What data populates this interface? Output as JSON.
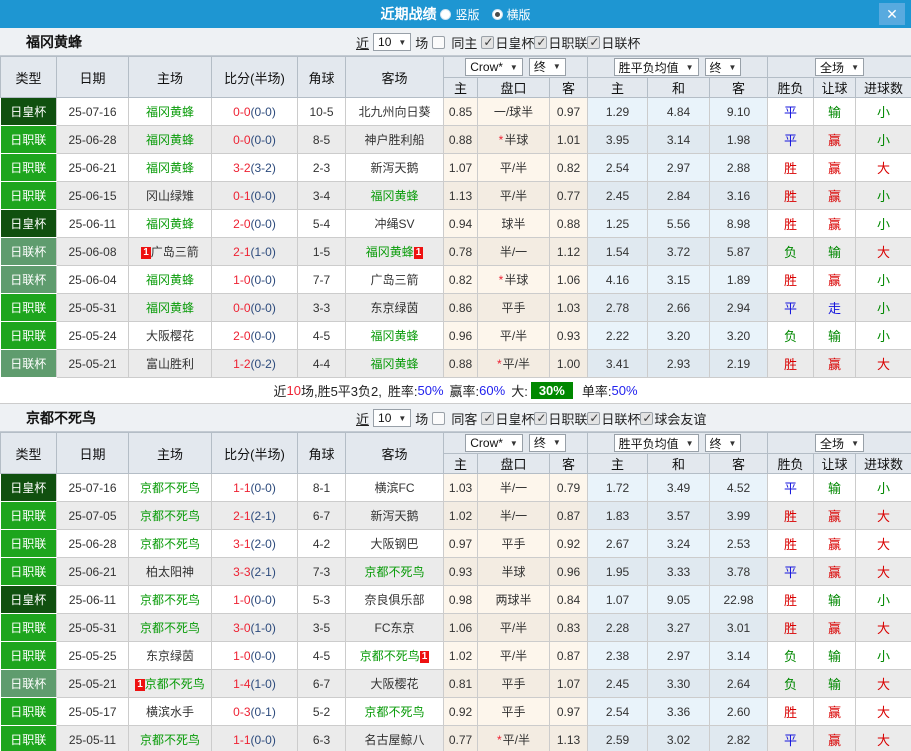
{
  "colors": {
    "titlebar-bg": "#1e96d2",
    "close-bg": "#58aadf",
    "type-emperor": "#10500f",
    "type-j1": "#1da51d",
    "type-lcup": "#5f9c6e",
    "focus-team": "#089b08",
    "score-red": "#ee2233",
    "half-navy": "#2c4a7c",
    "win-red": "#d90000",
    "draw-blue": "#1515dd",
    "lose-green": "#008800",
    "badge-red": "#ee1111",
    "summary-green-bg": "#008800",
    "summary-blue": "#2222ee"
  },
  "titlebar": {
    "title": "近期战绩",
    "radio_vertical": "竖版",
    "radio_horizontal": "横版",
    "close": "✕"
  },
  "table_columns": {
    "main": [
      "类型",
      "日期",
      "主场",
      "比分(半场)",
      "角球",
      "客场"
    ],
    "sub": [
      "主",
      "盘口",
      "客",
      "主",
      "和",
      "客",
      "胜负",
      "让球",
      "进球数"
    ]
  },
  "sections": [
    {
      "team": "福冈黄蜂",
      "filters": {
        "near_label": "近",
        "games": "10",
        "games_label": "场",
        "same_checked": false,
        "same_label": "同主",
        "leagues": [
          "日皇杯",
          "日职联",
          "日联杯"
        ]
      },
      "controls": {
        "odds_source": "Crow*",
        "odds_state": "终",
        "avg_label": "胜平负均值",
        "avg_state": "终",
        "scope": "全场"
      },
      "rows": [
        {
          "type": "日皇杯",
          "date": "25-07-16",
          "home": "福冈黄蜂",
          "home_focus": true,
          "home_card": "",
          "score": "0-0",
          "half": "0-0",
          "corner": "10-5",
          "away": "北九州向日葵",
          "away_focus": false,
          "away_card": "",
          "o_home": "0.85",
          "handicap": "一/球半",
          "h_star": false,
          "o_away": "0.97",
          "a_home": "1.29",
          "a_draw": "4.84",
          "a_away": "9.10",
          "res": "平",
          "hres": "输",
          "goal": "小"
        },
        {
          "type": "日职联",
          "date": "25-06-28",
          "home": "福冈黄蜂",
          "home_focus": true,
          "home_card": "",
          "score": "0-0",
          "half": "0-0",
          "corner": "8-5",
          "away": "神户胜利船",
          "away_focus": false,
          "away_card": "",
          "o_home": "0.88",
          "handicap": "半球",
          "h_star": true,
          "o_away": "1.01",
          "a_home": "3.95",
          "a_draw": "3.14",
          "a_away": "1.98",
          "res": "平",
          "hres": "赢",
          "goal": "小"
        },
        {
          "type": "日职联",
          "date": "25-06-21",
          "home": "福冈黄蜂",
          "home_focus": true,
          "home_card": "",
          "score": "3-2",
          "half": "3-2",
          "corner": "2-3",
          "away": "新泻天鹅",
          "away_focus": false,
          "away_card": "",
          "o_home": "1.07",
          "handicap": "平/半",
          "h_star": false,
          "o_away": "0.82",
          "a_home": "2.54",
          "a_draw": "2.97",
          "a_away": "2.88",
          "res": "胜",
          "hres": "赢",
          "goal": "大"
        },
        {
          "type": "日职联",
          "date": "25-06-15",
          "home": "冈山绿雉",
          "home_focus": false,
          "home_card": "",
          "score": "0-1",
          "half": "0-0",
          "corner": "3-4",
          "away": "福冈黄蜂",
          "away_focus": true,
          "away_card": "",
          "o_home": "1.13",
          "handicap": "平/半",
          "h_star": false,
          "o_away": "0.77",
          "a_home": "2.45",
          "a_draw": "2.84",
          "a_away": "3.16",
          "res": "胜",
          "hres": "赢",
          "goal": "小"
        },
        {
          "type": "日皇杯",
          "date": "25-06-11",
          "home": "福冈黄蜂",
          "home_focus": true,
          "home_card": "",
          "score": "2-0",
          "half": "0-0",
          "corner": "5-4",
          "away": "冲绳SV",
          "away_focus": false,
          "away_card": "",
          "o_home": "0.94",
          "handicap": "球半",
          "h_star": false,
          "o_away": "0.88",
          "a_home": "1.25",
          "a_draw": "5.56",
          "a_away": "8.98",
          "res": "胜",
          "hres": "赢",
          "goal": "小"
        },
        {
          "type": "日联杯",
          "date": "25-06-08",
          "home": "广岛三箭",
          "home_focus": false,
          "home_card": "1",
          "score": "2-1",
          "half": "1-0",
          "corner": "1-5",
          "away": "福冈黄蜂",
          "away_focus": true,
          "away_card": "1",
          "o_home": "0.78",
          "handicap": "半/一",
          "h_star": false,
          "o_away": "1.12",
          "a_home": "1.54",
          "a_draw": "3.72",
          "a_away": "5.87",
          "res": "负",
          "hres": "输",
          "goal": "大"
        },
        {
          "type": "日联杯",
          "date": "25-06-04",
          "home": "福冈黄蜂",
          "home_focus": true,
          "home_card": "",
          "score": "1-0",
          "half": "0-0",
          "corner": "7-7",
          "away": "广岛三箭",
          "away_focus": false,
          "away_card": "",
          "o_home": "0.82",
          "handicap": "半球",
          "h_star": true,
          "o_away": "1.06",
          "a_home": "4.16",
          "a_draw": "3.15",
          "a_away": "1.89",
          "res": "胜",
          "hres": "赢",
          "goal": "小"
        },
        {
          "type": "日职联",
          "date": "25-05-31",
          "home": "福冈黄蜂",
          "home_focus": true,
          "home_card": "",
          "score": "0-0",
          "half": "0-0",
          "corner": "3-3",
          "away": "东京绿茵",
          "away_focus": false,
          "away_card": "",
          "o_home": "0.86",
          "handicap": "平手",
          "h_star": false,
          "o_away": "1.03",
          "a_home": "2.78",
          "a_draw": "2.66",
          "a_away": "2.94",
          "res": "平",
          "hres": "走",
          "goal": "小"
        },
        {
          "type": "日职联",
          "date": "25-05-24",
          "home": "大阪樱花",
          "home_focus": false,
          "home_card": "",
          "score": "2-0",
          "half": "0-0",
          "corner": "4-5",
          "away": "福冈黄蜂",
          "away_focus": true,
          "away_card": "",
          "o_home": "0.96",
          "handicap": "平/半",
          "h_star": false,
          "o_away": "0.93",
          "a_home": "2.22",
          "a_draw": "3.20",
          "a_away": "3.20",
          "res": "负",
          "hres": "输",
          "goal": "小"
        },
        {
          "type": "日联杯",
          "date": "25-05-21",
          "home": "富山胜利",
          "home_focus": false,
          "home_card": "",
          "score": "1-2",
          "half": "0-2",
          "corner": "4-4",
          "away": "福冈黄蜂",
          "away_focus": true,
          "away_card": "",
          "o_home": "0.88",
          "handicap": "平/半",
          "h_star": true,
          "o_away": "1.00",
          "a_home": "3.41",
          "a_draw": "2.93",
          "a_away": "2.19",
          "res": "胜",
          "hres": "赢",
          "goal": "大"
        }
      ],
      "summary": {
        "prefix": "近",
        "count": "10",
        "record": "场,胜5平3负2,",
        "win_rate_label": "胜率:",
        "win_rate": "50%",
        "cover_label": "赢率:",
        "cover_rate": "60%",
        "big_label": "大:",
        "big_rate": "30%",
        "single_label": "单率:",
        "single_rate": "50%"
      }
    },
    {
      "team": "京都不死鸟",
      "filters": {
        "near_label": "近",
        "games": "10",
        "games_label": "场",
        "same_checked": false,
        "same_label": "同客",
        "leagues": [
          "日皇杯",
          "日职联",
          "日联杯",
          "球会友谊"
        ]
      },
      "controls": {
        "odds_source": "Crow*",
        "odds_state": "终",
        "avg_label": "胜平负均值",
        "avg_state": "终",
        "scope": "全场"
      },
      "rows": [
        {
          "type": "日皇杯",
          "date": "25-07-16",
          "home": "京都不死鸟",
          "home_focus": true,
          "home_card": "",
          "score": "1-1",
          "half": "0-0",
          "corner": "8-1",
          "away": "横滨FC",
          "away_focus": false,
          "away_card": "",
          "o_home": "1.03",
          "handicap": "半/一",
          "h_star": false,
          "o_away": "0.79",
          "a_home": "1.72",
          "a_draw": "3.49",
          "a_away": "4.52",
          "res": "平",
          "hres": "输",
          "goal": "小"
        },
        {
          "type": "日职联",
          "date": "25-07-05",
          "home": "京都不死鸟",
          "home_focus": true,
          "home_card": "",
          "score": "2-1",
          "half": "2-1",
          "corner": "6-7",
          "away": "新泻天鹅",
          "away_focus": false,
          "away_card": "",
          "o_home": "1.02",
          "handicap": "半/一",
          "h_star": false,
          "o_away": "0.87",
          "a_home": "1.83",
          "a_draw": "3.57",
          "a_away": "3.99",
          "res": "胜",
          "hres": "赢",
          "goal": "大"
        },
        {
          "type": "日职联",
          "date": "25-06-28",
          "home": "京都不死鸟",
          "home_focus": true,
          "home_card": "",
          "score": "3-1",
          "half": "2-0",
          "corner": "4-2",
          "away": "大阪钢巴",
          "away_focus": false,
          "away_card": "",
          "o_home": "0.97",
          "handicap": "平手",
          "h_star": false,
          "o_away": "0.92",
          "a_home": "2.67",
          "a_draw": "3.24",
          "a_away": "2.53",
          "res": "胜",
          "hres": "赢",
          "goal": "大"
        },
        {
          "type": "日职联",
          "date": "25-06-21",
          "home": "柏太阳神",
          "home_focus": false,
          "home_card": "",
          "score": "3-3",
          "half": "2-1",
          "corner": "7-3",
          "away": "京都不死鸟",
          "away_focus": true,
          "away_card": "",
          "o_home": "0.93",
          "handicap": "半球",
          "h_star": false,
          "o_away": "0.96",
          "a_home": "1.95",
          "a_draw": "3.33",
          "a_away": "3.78",
          "res": "平",
          "hres": "赢",
          "goal": "大"
        },
        {
          "type": "日皇杯",
          "date": "25-06-11",
          "home": "京都不死鸟",
          "home_focus": true,
          "home_card": "",
          "score": "1-0",
          "half": "0-0",
          "corner": "5-3",
          "away": "奈良俱乐部",
          "away_focus": false,
          "away_card": "",
          "o_home": "0.98",
          "handicap": "两球半",
          "h_star": false,
          "o_away": "0.84",
          "a_home": "1.07",
          "a_draw": "9.05",
          "a_away": "22.98",
          "res": "胜",
          "hres": "输",
          "goal": "小"
        },
        {
          "type": "日职联",
          "date": "25-05-31",
          "home": "京都不死鸟",
          "home_focus": true,
          "home_card": "",
          "score": "3-0",
          "half": "1-0",
          "corner": "3-5",
          "away": "FC东京",
          "away_focus": false,
          "away_card": "",
          "o_home": "1.06",
          "handicap": "平/半",
          "h_star": false,
          "o_away": "0.83",
          "a_home": "2.28",
          "a_draw": "3.27",
          "a_away": "3.01",
          "res": "胜",
          "hres": "赢",
          "goal": "大"
        },
        {
          "type": "日职联",
          "date": "25-05-25",
          "home": "东京绿茵",
          "home_focus": false,
          "home_card": "",
          "score": "1-0",
          "half": "0-0",
          "corner": "4-5",
          "away": "京都不死鸟",
          "away_focus": true,
          "away_card": "1",
          "o_home": "1.02",
          "handicap": "平/半",
          "h_star": false,
          "o_away": "0.87",
          "a_home": "2.38",
          "a_draw": "2.97",
          "a_away": "3.14",
          "res": "负",
          "hres": "输",
          "goal": "小"
        },
        {
          "type": "日联杯",
          "date": "25-05-21",
          "home": "京都不死鸟",
          "home_focus": true,
          "home_card": "1",
          "score": "1-4",
          "half": "1-0",
          "corner": "6-7",
          "away": "大阪樱花",
          "away_focus": false,
          "away_card": "",
          "o_home": "0.81",
          "handicap": "平手",
          "h_star": false,
          "o_away": "1.07",
          "a_home": "2.45",
          "a_draw": "3.30",
          "a_away": "2.64",
          "res": "负",
          "hres": "输",
          "goal": "大"
        },
        {
          "type": "日职联",
          "date": "25-05-17",
          "home": "横滨水手",
          "home_focus": false,
          "home_card": "",
          "score": "0-3",
          "half": "0-1",
          "corner": "5-2",
          "away": "京都不死鸟",
          "away_focus": true,
          "away_card": "",
          "o_home": "0.92",
          "handicap": "平手",
          "h_star": false,
          "o_away": "0.97",
          "a_home": "2.54",
          "a_draw": "3.36",
          "a_away": "2.60",
          "res": "胜",
          "hres": "赢",
          "goal": "大"
        },
        {
          "type": "日职联",
          "date": "25-05-11",
          "home": "京都不死鸟",
          "home_focus": true,
          "home_card": "",
          "score": "1-1",
          "half": "0-0",
          "corner": "6-3",
          "away": "名古屋鲸八",
          "away_focus": false,
          "away_card": "",
          "o_home": "0.77",
          "handicap": "平/半",
          "h_star": true,
          "o_away": "1.13",
          "a_home": "2.59",
          "a_draw": "3.02",
          "a_away": "2.82",
          "res": "平",
          "hres": "赢",
          "goal": "大"
        }
      ],
      "summary": null
    }
  ]
}
